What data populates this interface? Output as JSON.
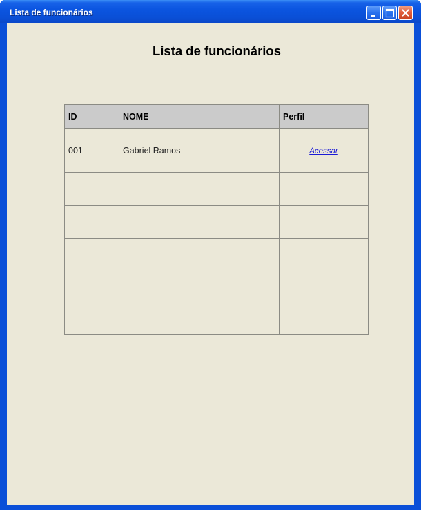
{
  "window": {
    "title": "Lista de funcionários"
  },
  "page": {
    "heading": "Lista de funcionários"
  },
  "table": {
    "headers": [
      "ID",
      "NOME",
      "Perfil"
    ],
    "rows": [
      {
        "id": "001",
        "nome": "Gabriel Ramos",
        "perfil_link": "Acessar"
      },
      {
        "id": "",
        "nome": "",
        "perfil_link": ""
      },
      {
        "id": "",
        "nome": "",
        "perfil_link": ""
      },
      {
        "id": "",
        "nome": "",
        "perfil_link": ""
      },
      {
        "id": "",
        "nome": "",
        "perfil_link": ""
      },
      {
        "id": "",
        "nome": "",
        "perfil_link": ""
      }
    ]
  },
  "icons": {
    "minimize": "minimize-icon",
    "maximize": "maximize-icon",
    "close": "close-icon"
  },
  "colors": {
    "titlebar": "#0a4fd8",
    "client_background": "#ebe8d8",
    "header_background": "#cbcbcb",
    "link": "#1b1bd6"
  }
}
